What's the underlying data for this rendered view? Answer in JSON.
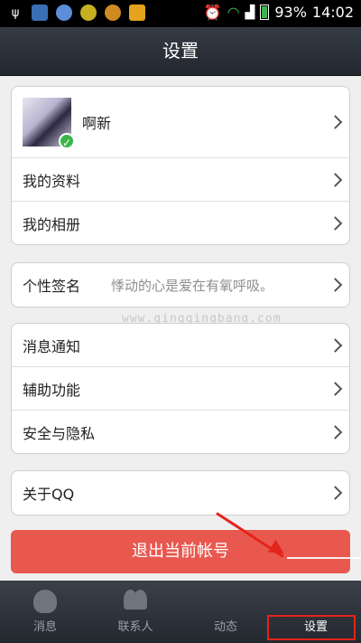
{
  "status_bar": {
    "battery": "93%",
    "time": "14:02",
    "icons": [
      "usb-icon",
      "app-icon-1",
      "app-icon-2",
      "app-icon-3",
      "app-icon-4",
      "app-icon-5",
      "alarm-icon",
      "wifi-icon",
      "signal-icon"
    ]
  },
  "header": {
    "title": "设置"
  },
  "profile": {
    "name": "啊新"
  },
  "account": {
    "profile_info": "我的资料",
    "album": "我的相册"
  },
  "signature": {
    "label": "个性签名",
    "value": "悸动的心是爱在有氧呼吸。"
  },
  "settings": {
    "notifications": "消息通知",
    "accessibility": "辅助功能",
    "security": "安全与隐私"
  },
  "about": {
    "label": "关于QQ"
  },
  "watermark": "www.qingqingbang.com",
  "logout": {
    "label": "退出当前帐号"
  },
  "tabs": [
    {
      "label": "消息",
      "icon": "qq-penguin-icon"
    },
    {
      "label": "联系人",
      "icon": "contacts-icon"
    },
    {
      "label": "动态",
      "icon": "feed-icon"
    },
    {
      "label": "设置",
      "icon": "settings-icon"
    }
  ],
  "colors": {
    "accent_red": "#e9584f",
    "annotation_red": "#e3241b",
    "header_bg": "#2c3038"
  }
}
